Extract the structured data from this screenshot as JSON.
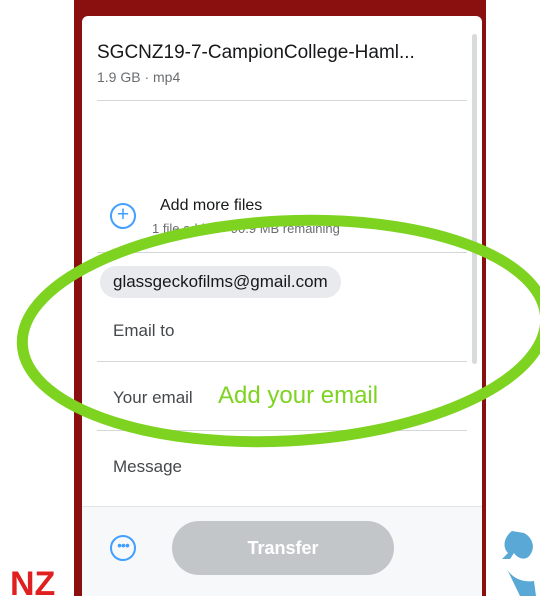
{
  "file": {
    "name": "SGCNZ19-7-CampionCollege-Haml...",
    "meta": "1.9 GB · mp4"
  },
  "add_files": {
    "label": "Add more files",
    "sub": "1 file added · 90.9 MB remaining"
  },
  "recipients": [
    "glassgeckofilms@gmail.com"
  ],
  "fields": {
    "email_to_placeholder": "Email to",
    "your_email_placeholder": "Your email",
    "message_placeholder": "Message"
  },
  "annotation": "Add your email",
  "transfer_label": "Transfer",
  "logos": {
    "left_text": "NZ"
  },
  "colors": {
    "accent": "#409fff",
    "highlight": "#7ed321",
    "frame": "#8a1010",
    "disabled_button": "#c3c6c9"
  }
}
